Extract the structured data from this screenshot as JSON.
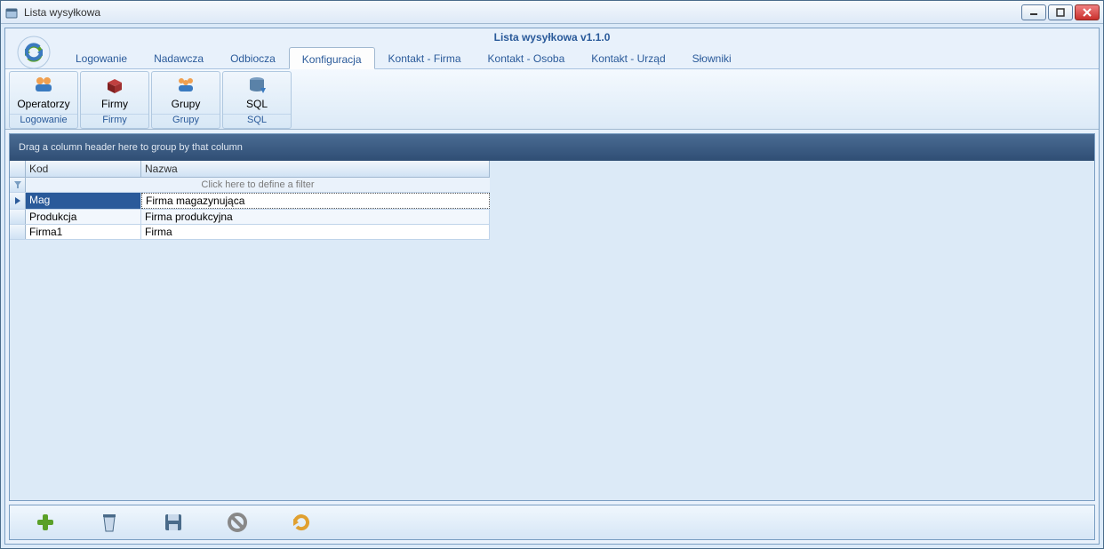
{
  "window": {
    "title": "Lista wysyłkowa"
  },
  "app": {
    "header": "Lista wysyłkowa v1.1.0"
  },
  "menubar": {
    "items": [
      "Logowanie",
      "Nadawcza",
      "Odbiocza",
      "Konfiguracja",
      "Kontakt - Firma",
      "Kontakt - Osoba",
      "Kontakt - Urząd",
      "Słowniki"
    ],
    "activeIndex": 3
  },
  "ribbon": {
    "groups": [
      {
        "button": "Operatorzy",
        "caption": "Logowanie"
      },
      {
        "button": "Firmy",
        "caption": "Firmy"
      },
      {
        "button": "Grupy",
        "caption": "Grupy"
      },
      {
        "button": "SQL",
        "caption": "SQL"
      }
    ]
  },
  "grid": {
    "groupHint": "Drag a column header here to group by that column",
    "columns": [
      "Kod",
      "Nazwa"
    ],
    "filterHint": "Click here to define a filter",
    "rows": [
      {
        "kod": "Mag",
        "nazwa": "Firma magazynująca",
        "selected": true
      },
      {
        "kod": "Produkcja",
        "nazwa": "Firma produkcyjna",
        "selected": false
      },
      {
        "kod": "Firma1",
        "nazwa": "Firma",
        "selected": false
      }
    ]
  },
  "toolbar": {
    "add": "add",
    "delete": "delete",
    "save": "save",
    "cancel": "cancel",
    "refresh": "refresh"
  }
}
